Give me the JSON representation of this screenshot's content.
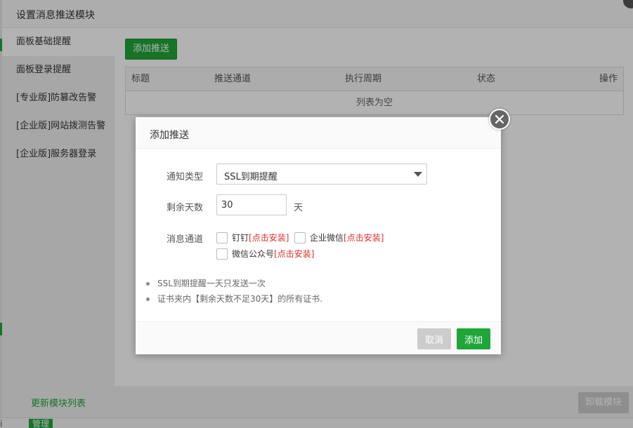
{
  "page": {
    "manage_label": "管理",
    "edge_text": "i"
  },
  "window": {
    "title": "设置消息推送模块"
  },
  "sidebar": {
    "items": [
      {
        "label": "面板基础提醒"
      },
      {
        "label": "面板登录提醒"
      },
      {
        "label": "[专业版]防篡改告警"
      },
      {
        "label": "[企业版]网站拨测告警"
      },
      {
        "label": "[企业版]服务器登录"
      }
    ],
    "footer_link": "更新模块列表"
  },
  "content": {
    "add_push_label": "添加推送",
    "table": {
      "columns": [
        "标题",
        "推送通道",
        "执行周期",
        "状态",
        "操作"
      ],
      "empty_text": "列表为空"
    },
    "uninstall_label": "卸载模块"
  },
  "dialog": {
    "title": "添加推送",
    "notify_type_label": "通知类型",
    "notify_type_value": "SSL到期提醒",
    "days_label": "剩余天数",
    "days_value": "30",
    "days_unit": "天",
    "channel_label": "消息通道",
    "channels": [
      {
        "name": "钉钉",
        "install": "[点击安装]",
        "checked": false
      },
      {
        "name": "企业微信",
        "install": "[点击安装]",
        "checked": false
      },
      {
        "name": "微信公众号",
        "install": "[点击安装]",
        "checked": false
      }
    ],
    "notes": [
      "SSL到期提醒一天只发送一次",
      "证书夹内【剩余天数不足30天】的所有证书."
    ],
    "cancel_label": "取消",
    "confirm_label": "添加"
  },
  "colors": {
    "primary_green": "#20a53a",
    "install_red": "#e02c2c",
    "disabled_gray": "#cccccc"
  }
}
